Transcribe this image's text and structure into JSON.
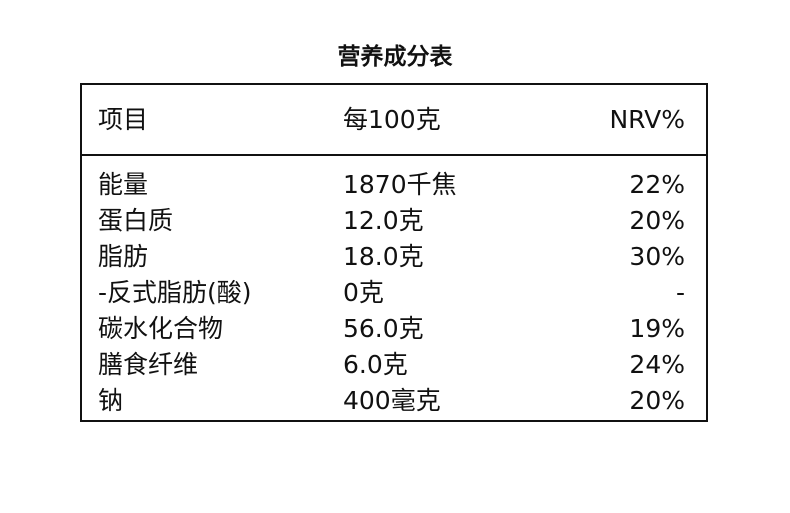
{
  "title": "营养成分表",
  "header": {
    "item": "项目",
    "per100": "每100克",
    "nrv": "NRV%"
  },
  "rows": [
    {
      "name": "能量",
      "amount": "1870千焦",
      "nrv": "22%"
    },
    {
      "name": "蛋白质",
      "amount": "12.0克",
      "nrv": "20%"
    },
    {
      "name": "脂肪",
      "amount": "18.0克",
      "nrv": "30%"
    },
    {
      "name": "-反式脂肪(酸)",
      "amount": "0克",
      "nrv": "-"
    },
    {
      "name": "碳水化合物",
      "amount": "56.0克",
      "nrv": "19%"
    },
    {
      "name": "膳食纤维",
      "amount": "6.0克",
      "nrv": "24%"
    },
    {
      "name": "钠",
      "amount": "400毫克",
      "nrv": "20%"
    }
  ]
}
